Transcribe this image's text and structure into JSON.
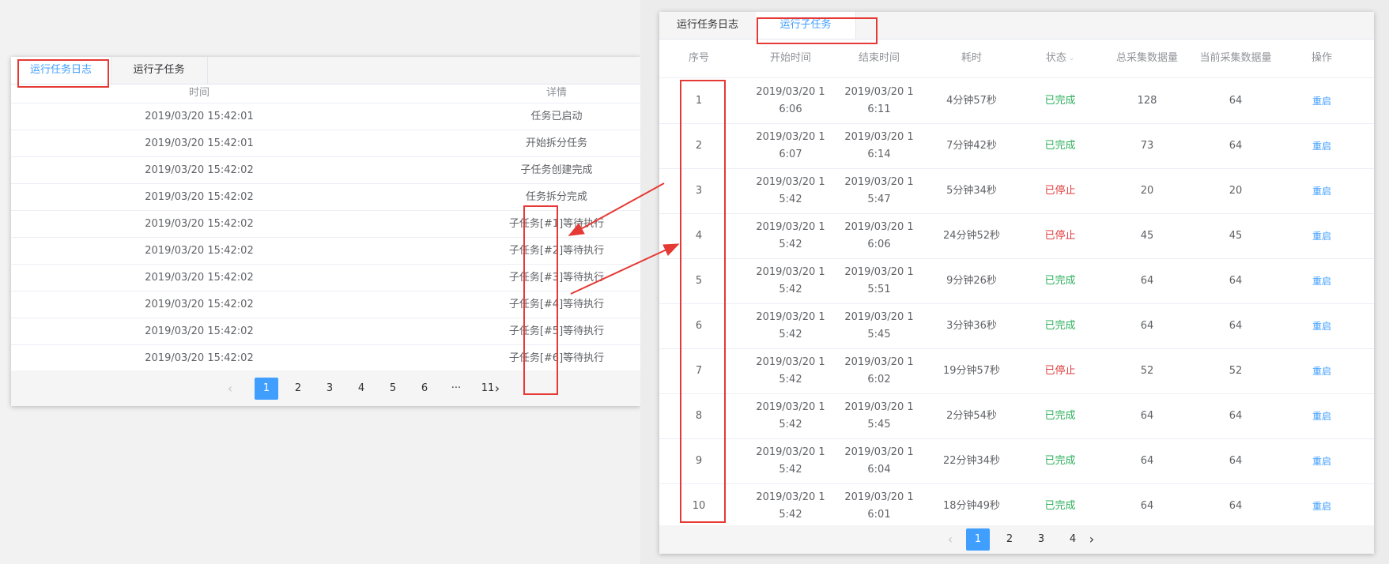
{
  "tabs": {
    "log": "运行任务日志",
    "sub": "运行子任务"
  },
  "left": {
    "headers": {
      "time": "时间",
      "detail": "详情"
    },
    "rows": [
      {
        "time": "2019/03/20 15:42:01",
        "detail": "任务已启动"
      },
      {
        "time": "2019/03/20 15:42:01",
        "detail": "开始拆分任务"
      },
      {
        "time": "2019/03/20 15:42:02",
        "detail": "子任务创建完成"
      },
      {
        "time": "2019/03/20 15:42:02",
        "detail": "任务拆分完成"
      },
      {
        "time": "2019/03/20 15:42:02",
        "detail": "子任务[#1]等待执行"
      },
      {
        "time": "2019/03/20 15:42:02",
        "detail": "子任务[#2]等待执行"
      },
      {
        "time": "2019/03/20 15:42:02",
        "detail": "子任务[#3]等待执行"
      },
      {
        "time": "2019/03/20 15:42:02",
        "detail": "子任务[#4]等待执行"
      },
      {
        "time": "2019/03/20 15:42:02",
        "detail": "子任务[#5]等待执行"
      },
      {
        "time": "2019/03/20 15:42:02",
        "detail": "子任务[#6]等待执行"
      }
    ],
    "pager": {
      "prev": "‹",
      "pages": [
        "1",
        "2",
        "3",
        "4",
        "5",
        "6",
        "···",
        "11"
      ],
      "next": "›",
      "current": "1"
    }
  },
  "right": {
    "headers": {
      "idx": "序号",
      "start": "开始时间",
      "end": "结束时间",
      "dur": "耗时",
      "status": "状态",
      "status_icon": "chevron-down-icon",
      "total": "总采集数据量",
      "cur": "当前采集数据量",
      "op": "操作"
    },
    "rows": [
      {
        "idx": "1",
        "start": "2019/03/20 16:06",
        "end": "2019/03/20 16:11",
        "dur": "4分钟57秒",
        "status": "已完成",
        "total": "128",
        "cur": "64",
        "op": "重启"
      },
      {
        "idx": "2",
        "start": "2019/03/20 16:07",
        "end": "2019/03/20 16:14",
        "dur": "7分钟42秒",
        "status": "已完成",
        "total": "73",
        "cur": "64",
        "op": "重启"
      },
      {
        "idx": "3",
        "start": "2019/03/20 15:42",
        "end": "2019/03/20 15:47",
        "dur": "5分钟34秒",
        "status": "已停止",
        "total": "20",
        "cur": "20",
        "op": "重启"
      },
      {
        "idx": "4",
        "start": "2019/03/20 15:42",
        "end": "2019/03/20 16:06",
        "dur": "24分钟52秒",
        "status": "已停止",
        "total": "45",
        "cur": "45",
        "op": "重启"
      },
      {
        "idx": "5",
        "start": "2019/03/20 15:42",
        "end": "2019/03/20 15:51",
        "dur": "9分钟26秒",
        "status": "已完成",
        "total": "64",
        "cur": "64",
        "op": "重启"
      },
      {
        "idx": "6",
        "start": "2019/03/20 15:42",
        "end": "2019/03/20 15:45",
        "dur": "3分钟36秒",
        "status": "已完成",
        "total": "64",
        "cur": "64",
        "op": "重启"
      },
      {
        "idx": "7",
        "start": "2019/03/20 15:42",
        "end": "2019/03/20 16:02",
        "dur": "19分钟57秒",
        "status": "已停止",
        "total": "52",
        "cur": "52",
        "op": "重启"
      },
      {
        "idx": "8",
        "start": "2019/03/20 15:42",
        "end": "2019/03/20 15:45",
        "dur": "2分钟54秒",
        "status": "已完成",
        "total": "64",
        "cur": "64",
        "op": "重启"
      },
      {
        "idx": "9",
        "start": "2019/03/20 15:42",
        "end": "2019/03/20 16:04",
        "dur": "22分钟34秒",
        "status": "已完成",
        "total": "64",
        "cur": "64",
        "op": "重启"
      },
      {
        "idx": "10",
        "start": "2019/03/20 15:42",
        "end": "2019/03/20 16:01",
        "dur": "18分钟49秒",
        "status": "已完成",
        "total": "64",
        "cur": "64",
        "op": "重启"
      }
    ],
    "pager": {
      "prev": "‹",
      "pages": [
        "1",
        "2",
        "3",
        "4"
      ],
      "next": "›",
      "current": "1"
    }
  },
  "colors": {
    "accent": "#409eff",
    "done": "#2eaf5c",
    "stopped": "#e03e3e",
    "annotation": "#e53935"
  }
}
